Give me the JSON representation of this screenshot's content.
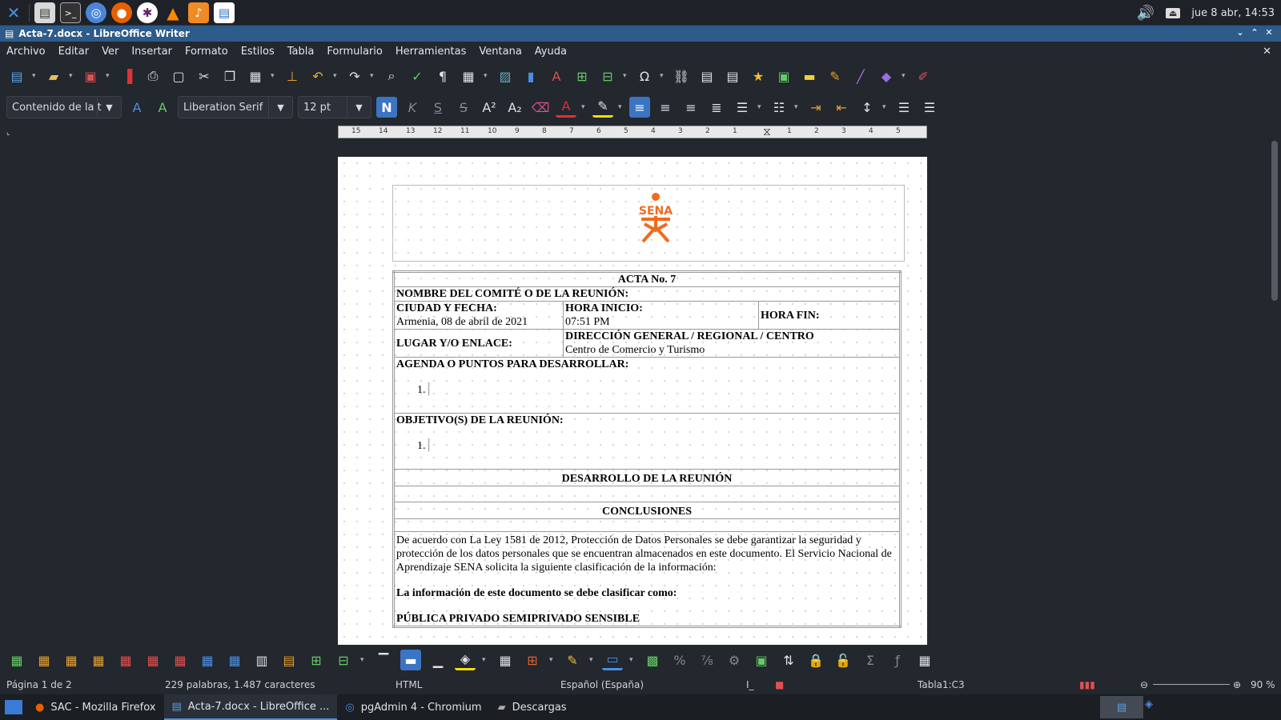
{
  "top_panel": {
    "launchers": [
      "xfce-icon",
      "file-manager-icon",
      "terminal-icon",
      "chromium-icon",
      "firefox-icon",
      "slack-icon",
      "vlc-icon",
      "music-icon",
      "writer-icon"
    ],
    "datetime": "jue  8 abr, 14:53"
  },
  "window": {
    "title": "Acta-7.docx - LibreOffice Writer"
  },
  "menu": [
    "Archivo",
    "Editar",
    "Ver",
    "Insertar",
    "Formato",
    "Estilos",
    "Tabla",
    "Formulario",
    "Herramientas",
    "Ventana",
    "Ayuda"
  ],
  "formatting": {
    "paragraph_style": "Contenido de la t",
    "font_name": "Liberation Serif",
    "font_size": "12 pt",
    "bold_glyph": "N",
    "italic_glyph": "K",
    "underline_glyph": "S",
    "strike_glyph": "S"
  },
  "ruler_ticks": [
    "15",
    "14",
    "13",
    "12",
    "11",
    "10",
    "9",
    "8",
    "7",
    "6",
    "5",
    "4",
    "3",
    "2",
    "1",
    "1",
    "2",
    "3",
    "4",
    "5"
  ],
  "document": {
    "logo_text": "SENA",
    "acta_title": "ACTA No. 7",
    "nombre_label": "NOMBRE DEL COMITÉ O DE LA REUNIÓN:",
    "ciudad_label": "CIUDAD Y FECHA:",
    "ciudad_value": "Armenia, 08 de abril de 2021",
    "hora_inicio_label": "HORA INICIO:",
    "hora_inicio_value": "07:51 PM",
    "hora_fin_label": "HORA FIN:",
    "lugar_label": "LUGAR Y/O ENLACE:",
    "direccion_label": "DIRECCIÓN GENERAL / REGIONAL / CENTRO",
    "direccion_value": "Centro de Comercio y Turismo",
    "agenda_label": "AGENDA O PUNTOS PARA DESARROLLAR:",
    "agenda_item": "1.",
    "objetivos_label": "OBJETIVO(S) DE LA REUNIÓN:",
    "objetivos_item": "1.",
    "desarrollo_label": "DESARROLLO DE LA REUNIÓN",
    "conclusiones_label": "CONCLUSIONES",
    "ley_text": "De acuerdo con La Ley 1581 de 2012, Protección de Datos Personales se debe garantizar la seguridad y protección de los datos personales que se encuentran almacenados en este documento. El Servicio Nacional de Aprendizaje SENA solicita la siguiente clasificación de la información:",
    "clasificar_label": "La información de este documento se debe clasificar como:",
    "clasificacion": "PÚBLICA PRIVADO SEMIPRIVADO SENSIBLE"
  },
  "status": {
    "page": "Página 1 de 2",
    "words": "229 palabras, 1.487 caracteres",
    "mode": "HTML",
    "language": "Español (España)",
    "table_cell": "Tabla1:C3",
    "zoom": "90 %"
  },
  "taskbar": [
    {
      "label": "SAC - Mozilla Firefox",
      "icon": "firefox-icon"
    },
    {
      "label": "Acta-7.docx - LibreOffice ...",
      "icon": "writer-icon"
    },
    {
      "label": "pgAdmin 4 - Chromium",
      "icon": "chromium-icon"
    },
    {
      "label": "Descargas",
      "icon": "folder-icon"
    }
  ],
  "colors": {
    "accent": "#3b74c2",
    "sena_orange": "#f06b1d",
    "titlebar": "#2d5b8a"
  }
}
